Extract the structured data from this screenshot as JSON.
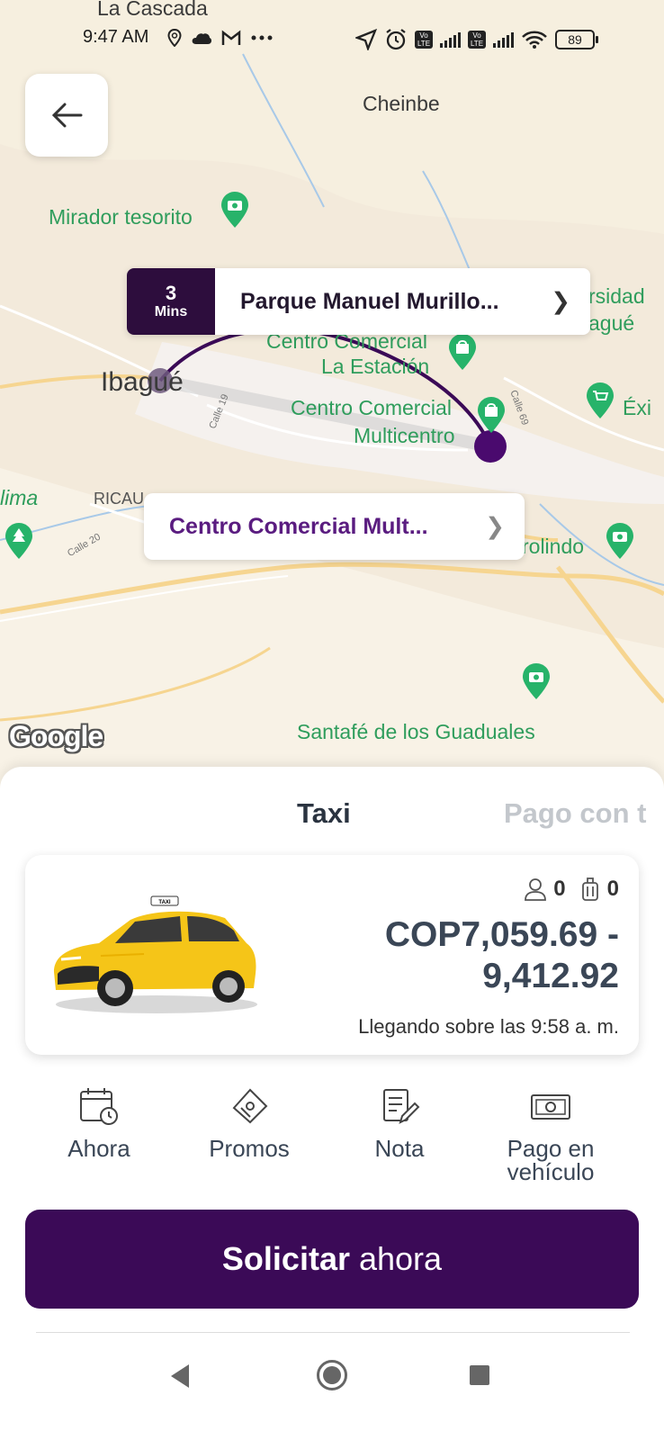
{
  "status_bar": {
    "top_label": "La Cascada",
    "time": "9:47 AM",
    "battery": "89",
    "volte_1": "Vo LTE",
    "volte_2": "Vo LTE"
  },
  "map": {
    "labels": {
      "cheinbe": "Cheinbe",
      "mirador": "Mirador tesorito",
      "ibague": "Ibagué",
      "estacion_1": "Centro Comercial",
      "estacion_2": "La Estación",
      "multicentro_1": "Centro Comercial",
      "multicentro_2": "Multicentro",
      "universidad_1": "rsidad",
      "universidad_2": "agué",
      "exito": "Éxi",
      "lima": "lima",
      "ricaurte": "RICAU",
      "arrolindo": "rolindo",
      "santafe": "Santafé de los Guaduales",
      "calle19": "Calle 19",
      "calle20": "Calle 20",
      "calle69": "Calle 69"
    },
    "google_logo": "Google",
    "route_color": "#3b0a57"
  },
  "destination": {
    "eta_value": "3",
    "eta_unit": "Mins",
    "name": "Parque Manuel Murillo..."
  },
  "origin": {
    "name": "Centro Comercial Mult..."
  },
  "sheet": {
    "tabs": [
      {
        "label": "Taxi",
        "active": true
      },
      {
        "label": "Pago con t",
        "active": false
      }
    ],
    "vehicle": {
      "passengers": "0",
      "luggage": "0",
      "price_line1": "COP7,059.69 -",
      "price_line2": "9,412.92",
      "arrival": "Llegando sobre las 9:58 a. m.",
      "car_sign": "TAXI",
      "car_color": "#f5c518"
    },
    "options": [
      {
        "label": "Ahora",
        "icon": "calendar-clock-icon"
      },
      {
        "label": "Promos",
        "icon": "ticket-icon"
      },
      {
        "label": "Nota",
        "icon": "note-pencil-icon"
      },
      {
        "label_line1": "Pago en",
        "label_line2": "vehículo",
        "icon": "cash-icon"
      }
    ],
    "request_button": {
      "bold": "Solicitar",
      "rest": "ahora",
      "color": "#3b0a57"
    }
  }
}
